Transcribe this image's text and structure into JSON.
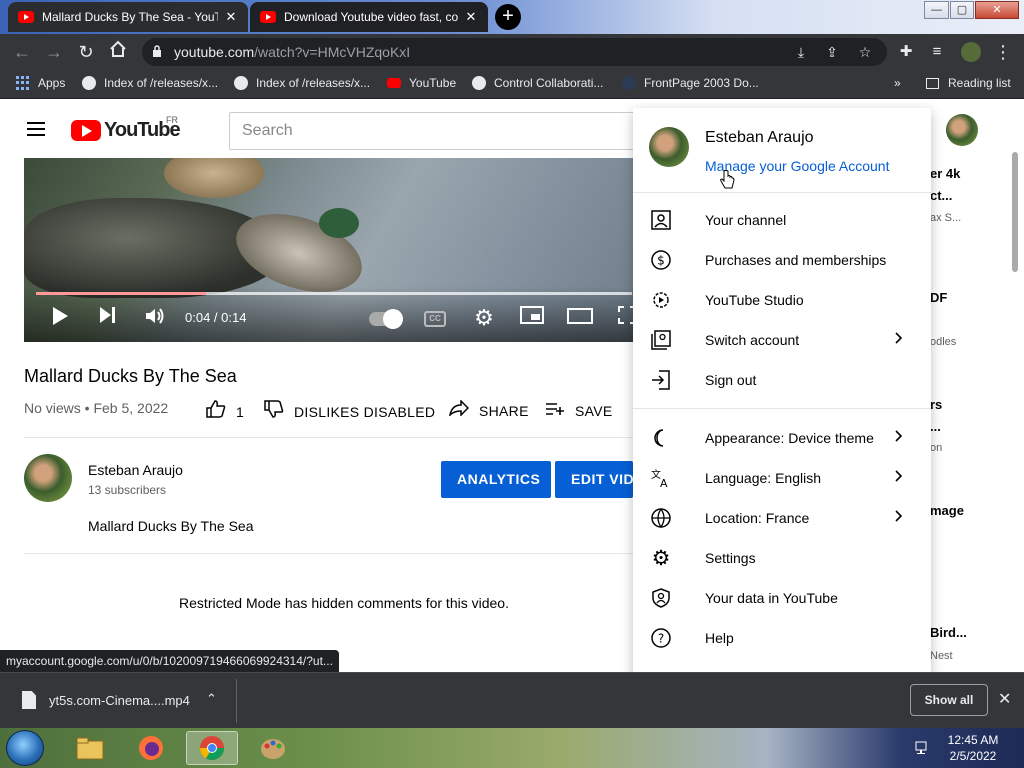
{
  "browser": {
    "tabs": [
      {
        "title": "Mallard Ducks By The Sea - YouTube",
        "active": false
      },
      {
        "title": "Download Youtube video fast, co",
        "active": true
      }
    ],
    "window_buttons": {
      "minimize": "—",
      "maximize": "▢",
      "close": "✕"
    },
    "url_host": "youtube.com",
    "url_path": "/watch?v=HMcVHZqoKxI",
    "bookmarks": [
      {
        "label": "Apps",
        "icon": "apps-grid-icon"
      },
      {
        "label": "Index of /releases/x...",
        "icon": "globe-icon"
      },
      {
        "label": "Index of /releases/x...",
        "icon": "globe-icon"
      },
      {
        "label": "YouTube",
        "icon": "youtube-icon"
      },
      {
        "label": "Control Collaborati...",
        "icon": "globe-icon"
      },
      {
        "label": "FrontPage 2003 Do...",
        "icon": "frontpage-icon"
      }
    ],
    "bookmarks_overflow": "»",
    "reading_list": "Reading list"
  },
  "youtube": {
    "logo_text": "YouTube",
    "country_code": "FR",
    "search_placeholder": "Search",
    "player": {
      "time": "0:04 / 0:14",
      "progress_fraction": 0.286,
      "loaded_fraction": 1.0
    },
    "video": {
      "title": "Mallard Ducks By The Sea",
      "meta": "No views • Feb 5, 2022",
      "likes": "1",
      "dislike_label": "DISLIKES DISABLED",
      "share_label": "SHARE",
      "save_label": "SAVE"
    },
    "channel": {
      "name": "Esteban Araujo",
      "subscribers": "13 subscribers",
      "analytics_label": "ANALYTICS",
      "edit_label": "EDIT VIDEO",
      "description": "Mallard Ducks By The Sea"
    },
    "restricted_notice": "Restricted Mode has hidden comments for this video.",
    "right_column": [
      "er 4k",
      "ct...",
      "ax S...",
      "DF",
      "odles",
      "rs",
      "...",
      "on",
      "mage",
      "Bird...",
      "Nest"
    ]
  },
  "account_menu": {
    "name": "Esteban Araujo",
    "manage_link": "Manage your Google Account",
    "items": [
      {
        "label": "Your channel",
        "icon": "person-box-icon",
        "chevron": false
      },
      {
        "label": "Purchases and memberships",
        "icon": "dollar-circle-icon",
        "chevron": false
      },
      {
        "label": "YouTube Studio",
        "icon": "studio-gear-icon",
        "chevron": false
      },
      {
        "label": "Switch account",
        "icon": "switch-account-icon",
        "chevron": true
      },
      {
        "label": "Sign out",
        "icon": "sign-out-icon",
        "chevron": false
      },
      {
        "label": "Appearance: Device theme",
        "icon": "half-moon-icon",
        "chevron": true
      },
      {
        "label": "Language: English",
        "icon": "translate-icon",
        "chevron": true
      },
      {
        "label": "Location: France",
        "icon": "globe-icon",
        "chevron": true
      },
      {
        "label": "Settings",
        "icon": "gear-icon",
        "chevron": false
      },
      {
        "label": "Your data in YouTube",
        "icon": "shield-person-icon",
        "chevron": false
      },
      {
        "label": "Help",
        "icon": "help-icon",
        "chevron": false
      }
    ]
  },
  "status_url": "myaccount.google.com/u/0/b/102009719466069924314/?ut...",
  "download_shelf": {
    "file_name": "yt5s.com-Cinema....mp4",
    "show_all": "Show all"
  },
  "taskbar": {
    "time": "12:45 AM",
    "date": "2/5/2022"
  },
  "colors": {
    "youtube_red": "#ff0000",
    "link_blue": "#065fd4",
    "chrome_dark": "#35363a"
  }
}
